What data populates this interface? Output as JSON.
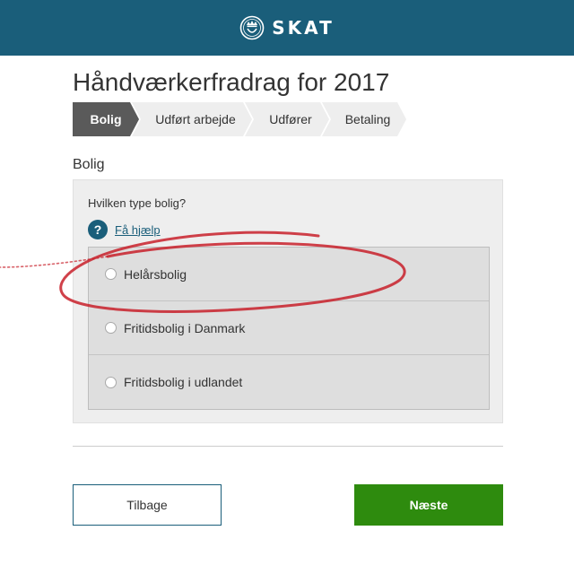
{
  "header": {
    "logo_text": "SKAT"
  },
  "page": {
    "title": "Håndværkerfradrag for 2017"
  },
  "steps": [
    {
      "label": "Bolig",
      "active": true
    },
    {
      "label": "Udført arbejde",
      "active": false
    },
    {
      "label": "Udfører",
      "active": false
    },
    {
      "label": "Betaling",
      "active": false
    }
  ],
  "section": {
    "title": "Bolig"
  },
  "form": {
    "question": "Hvilken type bolig?",
    "help_label": "Få hjælp",
    "help_icon": "?",
    "options": [
      {
        "label": "Helårsbolig",
        "selected": false
      },
      {
        "label": "Fritidsbolig i Danmark",
        "selected": false
      },
      {
        "label": "Fritidsbolig i udlandet",
        "selected": false
      }
    ]
  },
  "buttons": {
    "back_label": "Tilbage",
    "next_label": "Næste"
  },
  "colors": {
    "header": "#1a5e7a",
    "accent": "#1a5e7a",
    "primary_button": "#2e8b0e",
    "active_step": "#5a5a5a",
    "annotation": "#c8202a"
  }
}
